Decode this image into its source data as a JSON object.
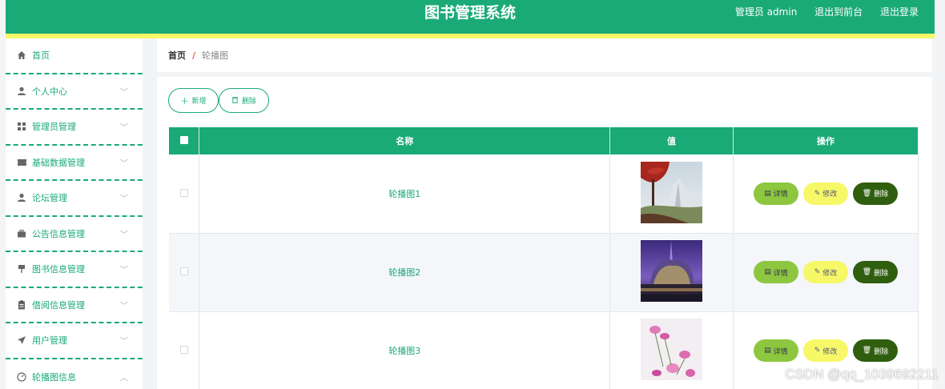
{
  "header": {
    "title": "图书管理系统",
    "admin_label": "管理员 admin",
    "to_front": "退出到前台",
    "logout": "退出登录"
  },
  "sidebar": {
    "items": [
      {
        "label": "首页",
        "icon": "home-icon",
        "arrow": ""
      },
      {
        "label": "个人中心",
        "icon": "user-icon",
        "arrow": "chevron-down-icon"
      },
      {
        "label": "管理员管理",
        "icon": "grid-icon",
        "arrow": "chevron-down-icon"
      },
      {
        "label": "基础数据管理",
        "icon": "ticket-icon",
        "arrow": "chevron-down-icon"
      },
      {
        "label": "论坛管理",
        "icon": "user-icon",
        "arrow": "chevron-down-icon"
      },
      {
        "label": "公告信息管理",
        "icon": "briefcase-icon",
        "arrow": "chevron-down-icon"
      },
      {
        "label": "图书信息管理",
        "icon": "flag-icon",
        "arrow": "chevron-down-icon"
      },
      {
        "label": "借阅信息管理",
        "icon": "clipboard-icon",
        "arrow": "chevron-down-icon"
      },
      {
        "label": "用户管理",
        "icon": "send-icon",
        "arrow": "chevron-down-icon"
      },
      {
        "label": "轮播图信息",
        "icon": "gauge-icon",
        "arrow": "chevron-up-icon"
      }
    ]
  },
  "breadcrumb": {
    "home": "首页",
    "separator": "/",
    "current": "轮播图"
  },
  "toolbar": {
    "add_label": "新增",
    "delete_label": "删除"
  },
  "table": {
    "headers": {
      "name": "名称",
      "value": "值",
      "actions": "操作"
    },
    "rows": [
      {
        "name": "轮播图1",
        "image": "red-tree-building-image"
      },
      {
        "name": "轮播图2",
        "image": "night-building-image"
      },
      {
        "name": "轮播图3",
        "image": "pink-flowers-image"
      }
    ],
    "actions": {
      "detail": "详情",
      "edit": "修改",
      "delete": "删除"
    }
  },
  "watermark": "CSDN @qq_1039692211",
  "colors": {
    "brand": "#1aaa77",
    "accent": "#f6f867",
    "detail": "#8dc63f",
    "delete": "#2f5e0f"
  }
}
